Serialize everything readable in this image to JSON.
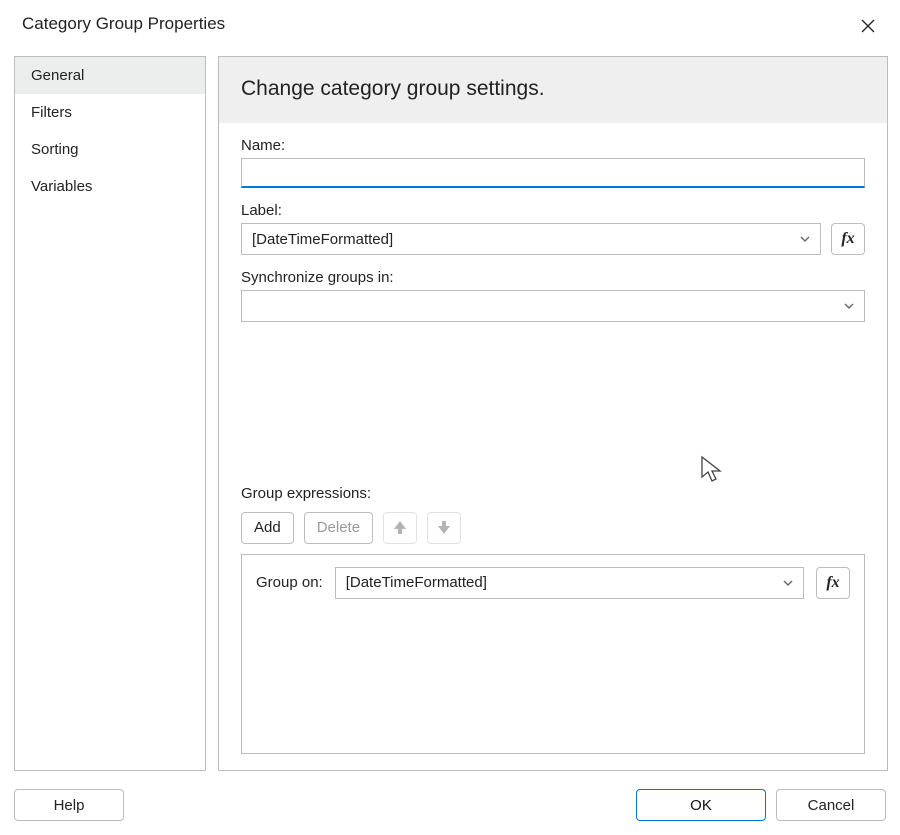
{
  "title": "Category Group Properties",
  "sidebar": {
    "items": [
      {
        "label": "General",
        "selected": true
      },
      {
        "label": "Filters",
        "selected": false
      },
      {
        "label": "Sorting",
        "selected": false
      },
      {
        "label": "Variables",
        "selected": false
      }
    ]
  },
  "main": {
    "heading": "Change category group settings.",
    "name_label": "Name:",
    "name_value": "",
    "label_label": "Label:",
    "label_value": "[DateTimeFormatted]",
    "sync_label": "Synchronize groups in:",
    "sync_value": "",
    "expr_heading": "Group expressions:",
    "buttons": {
      "add": "Add",
      "delete": "Delete"
    },
    "group_on_label": "Group on:",
    "group_on_value": "[DateTimeFormatted]",
    "fx_label": "fx"
  },
  "footer": {
    "help": "Help",
    "ok": "OK",
    "cancel": "Cancel"
  }
}
